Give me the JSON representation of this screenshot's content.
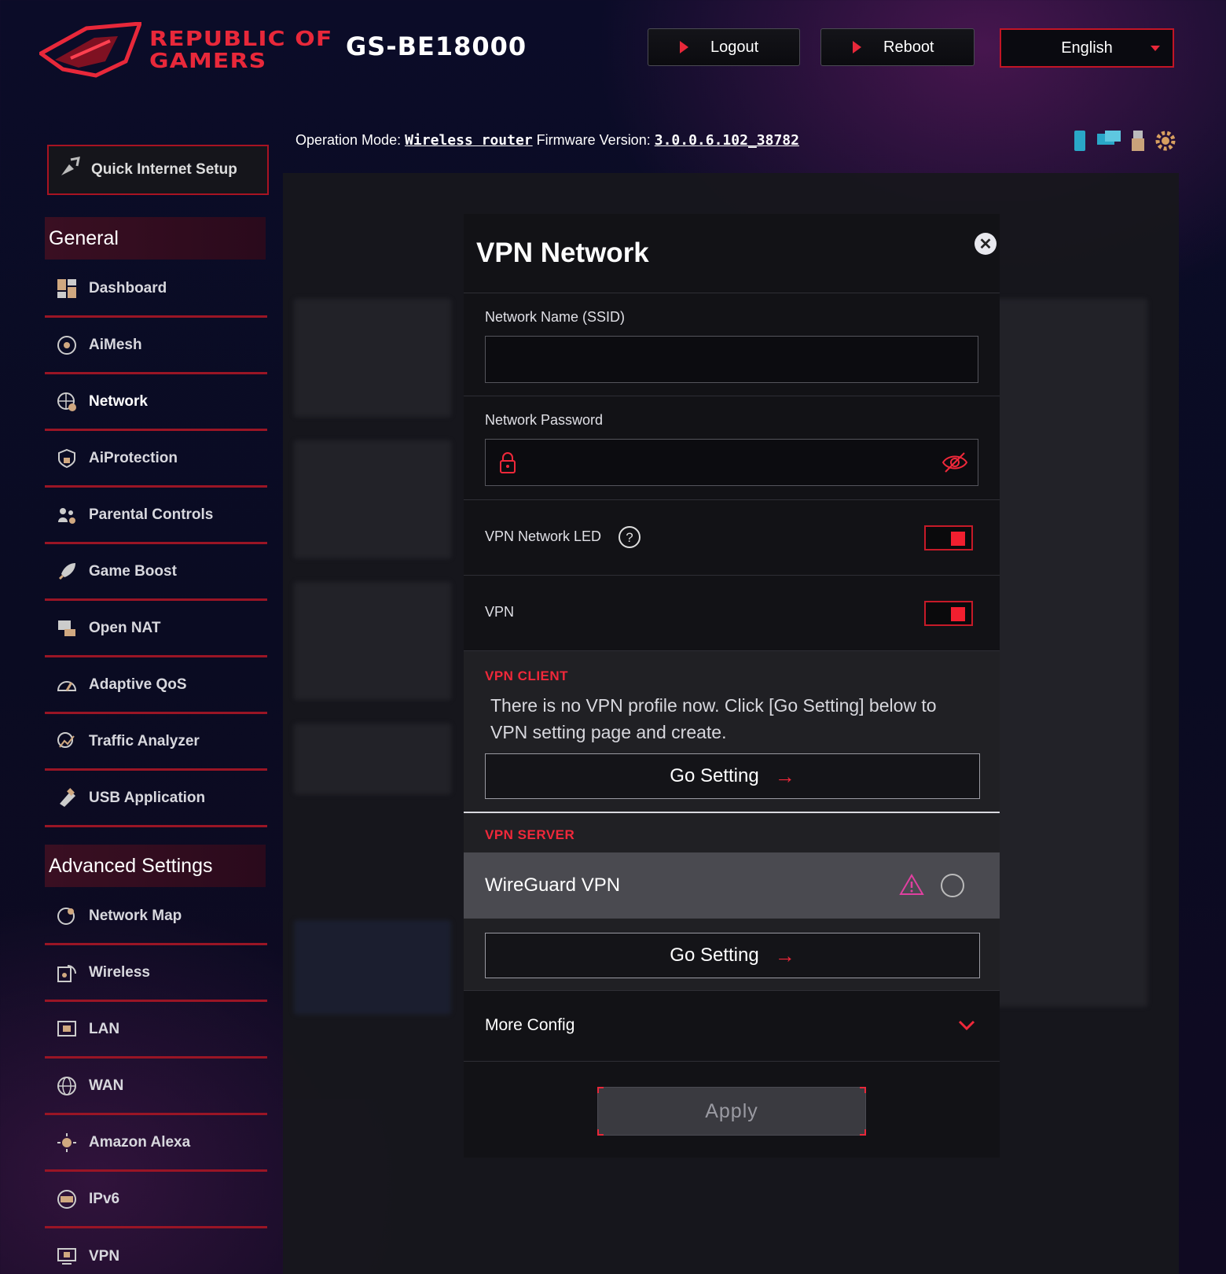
{
  "header": {
    "brand_line1": "REPUBLIC OF",
    "brand_line2": "GAMERS",
    "model": "GS-BE18000",
    "logout_label": "Logout",
    "reboot_label": "Reboot",
    "language": "English"
  },
  "status": {
    "operation_mode_label": "Operation Mode:",
    "operation_mode_value": "Wireless router",
    "firmware_label": "Firmware Version:",
    "firmware_value": "3.0.0.6.102_38782"
  },
  "sidebar": {
    "quick_setup": "Quick Internet Setup",
    "general_title": "General",
    "general_items": [
      {
        "label": "Dashboard",
        "icon": "dashboard-icon"
      },
      {
        "label": "AiMesh",
        "icon": "aimesh-icon"
      },
      {
        "label": "Network",
        "icon": "network-icon"
      },
      {
        "label": "AiProtection",
        "icon": "shield-icon"
      },
      {
        "label": "Parental Controls",
        "icon": "parental-icon"
      },
      {
        "label": "Game Boost",
        "icon": "rocket-icon"
      },
      {
        "label": "Open NAT",
        "icon": "nat-icon"
      },
      {
        "label": "Adaptive QoS",
        "icon": "gauge-icon"
      },
      {
        "label": "Traffic Analyzer",
        "icon": "analyzer-icon"
      },
      {
        "label": "USB Application",
        "icon": "usb-icon"
      }
    ],
    "advanced_title": "Advanced Settings",
    "advanced_items": [
      {
        "label": "Network Map",
        "icon": "network-map-icon"
      },
      {
        "label": "Wireless",
        "icon": "wireless-icon"
      },
      {
        "label": "LAN",
        "icon": "lan-icon"
      },
      {
        "label": "WAN",
        "icon": "globe-icon"
      },
      {
        "label": "Amazon Alexa",
        "icon": "alexa-icon"
      },
      {
        "label": "IPv6",
        "icon": "ipv6-icon"
      },
      {
        "label": "VPN",
        "icon": "vpn-icon"
      }
    ]
  },
  "modal": {
    "title": "VPN Network",
    "ssid_label": "Network Name (SSID)",
    "ssid_value": "",
    "password_label": "Network Password",
    "password_value": "",
    "led_label": "VPN Network LED",
    "vpn_label": "VPN",
    "vpn_client_title": "VPN CLIENT",
    "vpn_client_message": "There is no VPN profile now. Click [Go Setting] below to VPN setting page and create.",
    "go_setting_label": "Go Setting",
    "vpn_server_title": "VPN SERVER",
    "wireguard_label": "WireGuard VPN",
    "more_config_label": "More Config",
    "apply_label": "Apply"
  },
  "colors": {
    "accent": "#e8283a",
    "warning": "#e040a0"
  }
}
